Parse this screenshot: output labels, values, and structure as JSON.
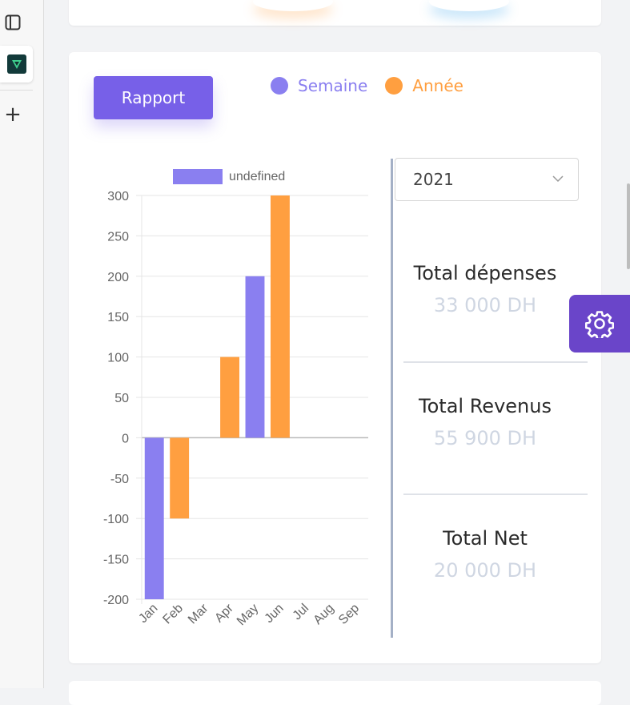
{
  "sidebar": {
    "icons": [
      "panel-layout-icon",
      "app-logo-icon",
      "plus-icon"
    ]
  },
  "card": {
    "report_button": "Rapport",
    "legend": [
      {
        "label": "Semaine",
        "color": "#8a7ff0"
      },
      {
        "label": "Année",
        "color": "#ff9f40"
      }
    ]
  },
  "year_select": {
    "value": "2021"
  },
  "stats": [
    {
      "label": "Total dépenses",
      "amount": "33 000 DH"
    },
    {
      "label": "Total Revenus",
      "amount": "55 900 DH"
    },
    {
      "label": "Total Net",
      "amount": "20 000 DH"
    }
  ],
  "chart_data": {
    "type": "bar",
    "legend_label": "undefined",
    "categories": [
      "Jan",
      "Feb",
      "Mar",
      "Apr",
      "May",
      "Jun",
      "Jul",
      "Aug",
      "Sep"
    ],
    "values": [
      -200,
      -100,
      0,
      100,
      200,
      300,
      0,
      0,
      0
    ],
    "bar_colors": [
      "#8a7ff0",
      "#ff9f40",
      "#8a7ff0",
      "#ff9f40",
      "#8a7ff0",
      "#ff9f40",
      "#8a7ff0",
      "#ff9f40",
      "#8a7ff0"
    ],
    "ylim": [
      -200,
      300
    ],
    "yticks": [
      300,
      250,
      200,
      150,
      100,
      50,
      0,
      -50,
      -100,
      -150,
      -200
    ],
    "grid": true,
    "legend_position": "top"
  }
}
